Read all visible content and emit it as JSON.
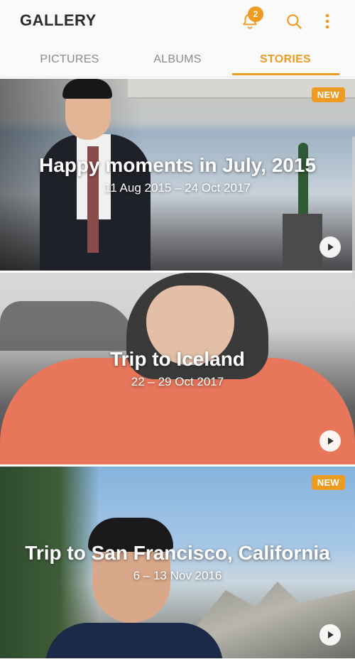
{
  "header": {
    "title": "GALLERY",
    "notification_count": "2",
    "icons": {
      "bell": "bell-icon",
      "search": "search-icon",
      "more": "more-vert-icon"
    },
    "accent_color": "#ee9b22"
  },
  "tabs": [
    {
      "label": "PICTURES",
      "active": false
    },
    {
      "label": "ALBUMS",
      "active": false
    },
    {
      "label": "STORIES",
      "active": true
    }
  ],
  "stories": [
    {
      "title": "Happy moments in July, 2015",
      "dates": "11 Aug 2015 – 24 Oct 2017",
      "badge": "NEW"
    },
    {
      "title": "Trip to Iceland",
      "dates": "22 – 29 Oct 2017",
      "badge": ""
    },
    {
      "title": "Trip to San Francisco, California",
      "dates": "6 – 13 Nov 2016",
      "badge": "NEW"
    }
  ]
}
